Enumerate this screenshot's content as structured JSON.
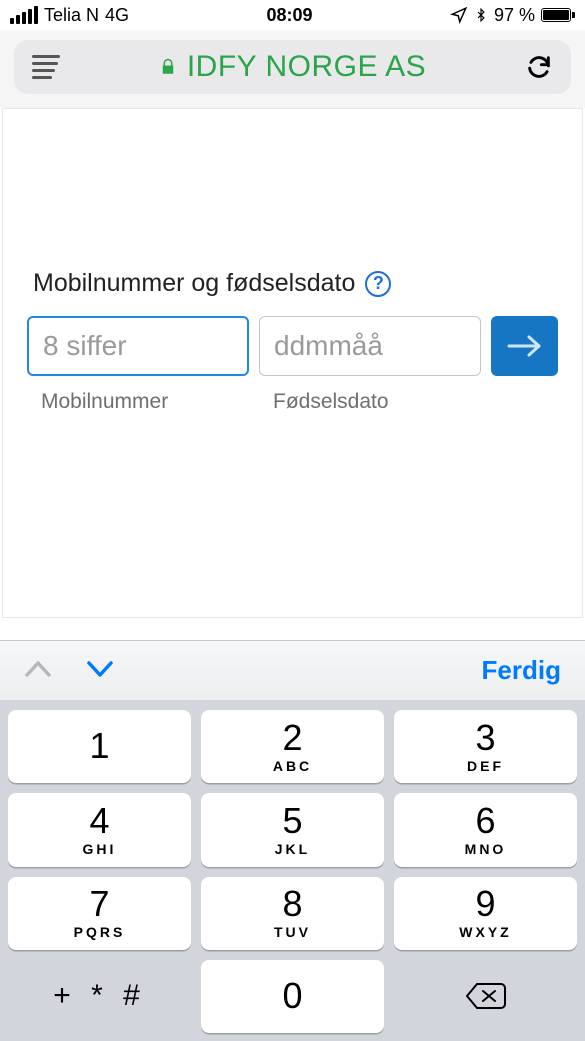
{
  "status": {
    "carrier": "Telia N",
    "network": "4G",
    "time": "08:09",
    "battery_percent": "97 %"
  },
  "browser": {
    "site_title": "IDFY NORGE AS"
  },
  "form": {
    "heading": "Mobilnummer og fødselsdato",
    "help_symbol": "?",
    "mobile": {
      "placeholder": "8 siffer",
      "label": "Mobilnummer"
    },
    "dob": {
      "placeholder": "ddmmåå",
      "label": "Fødselsdato"
    }
  },
  "keyboard": {
    "done": "Ferdig",
    "keys": [
      {
        "digit": "1",
        "letters": ""
      },
      {
        "digit": "2",
        "letters": "ABC"
      },
      {
        "digit": "3",
        "letters": "DEF"
      },
      {
        "digit": "4",
        "letters": "GHI"
      },
      {
        "digit": "5",
        "letters": "JKL"
      },
      {
        "digit": "6",
        "letters": "MNO"
      },
      {
        "digit": "7",
        "letters": "PQRS"
      },
      {
        "digit": "8",
        "letters": "TUV"
      },
      {
        "digit": "9",
        "letters": "WXYZ"
      }
    ],
    "zero": "0",
    "symbols": "+ * #"
  }
}
